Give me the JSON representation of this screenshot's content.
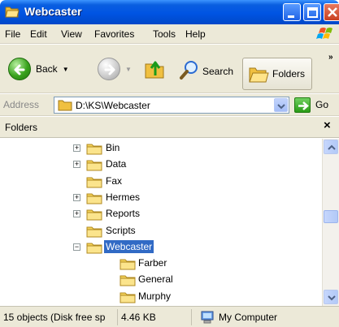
{
  "window": {
    "title": "Webcaster",
    "icon": "folder-open-icon"
  },
  "menu": {
    "items": [
      "File",
      "Edit",
      "View",
      "Favorites",
      "Tools",
      "Help"
    ]
  },
  "toolbar": {
    "back_label": "Back",
    "search_label": "Search",
    "folders_label": "Folders",
    "more": "»"
  },
  "address": {
    "label": "Address",
    "value": "D:\\KS\\Webcaster",
    "go_label": "Go"
  },
  "pane": {
    "title": "Folders",
    "close": "×"
  },
  "tree": [
    {
      "label": "Bin",
      "expander": "+",
      "level": 0
    },
    {
      "label": "Data",
      "expander": "+",
      "level": 0
    },
    {
      "label": "Fax",
      "expander": "",
      "level": 0
    },
    {
      "label": "Hermes",
      "expander": "+",
      "level": 0
    },
    {
      "label": "Reports",
      "expander": "+",
      "level": 0
    },
    {
      "label": "Scripts",
      "expander": "",
      "level": 0
    },
    {
      "label": "Webcaster",
      "expander": "−",
      "level": 0,
      "selected": true
    },
    {
      "label": "Farber",
      "expander": "",
      "level": 1
    },
    {
      "label": "General",
      "expander": "",
      "level": 1
    },
    {
      "label": "Murphy",
      "expander": "",
      "level": 1
    }
  ],
  "status": {
    "objects": "15 objects (Disk free sp",
    "size": "4.46 KB",
    "location": "My Computer"
  },
  "colors": {
    "title_blue": "#0054e3",
    "selection": "#316ac5",
    "chrome": "#ece9d8",
    "folder_yellow": "#f5d35a"
  }
}
